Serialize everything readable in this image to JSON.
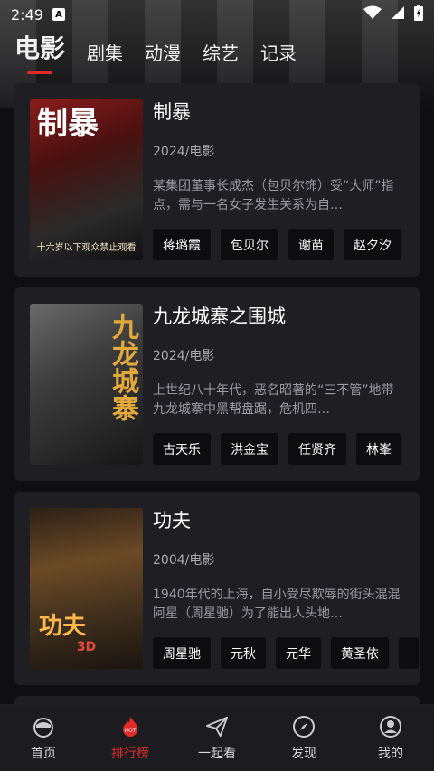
{
  "status": {
    "time": "2:49"
  },
  "categories": [
    {
      "label": "电影",
      "active": true
    },
    {
      "label": "剧集",
      "active": false
    },
    {
      "label": "动漫",
      "active": false
    },
    {
      "label": "综艺",
      "active": false
    },
    {
      "label": "记录",
      "active": false
    }
  ],
  "movies": [
    {
      "title": "制暴",
      "meta": "2024/电影",
      "desc": "某集团董事长成杰（包贝尔饰）受“大师”指点，需与一名女子发生关系为自…",
      "poster_text": "十六岁以下观众禁止观看",
      "poster_big": "制暴",
      "tags": [
        "蒋璐霞",
        "包贝尔",
        "谢苗",
        "赵夕汐"
      ]
    },
    {
      "title": "九龙城寨之围城",
      "meta": "2024/电影",
      "desc": "上世纪八十年代，恶名昭著的“三不管”地带九龙城寨中黑帮盘踞，危机四…",
      "poster_big": "九龙城寨",
      "tags": [
        "古天乐",
        "洪金宝",
        "任贤齐",
        "林峯"
      ]
    },
    {
      "title": "功夫",
      "meta": "2004/电影",
      "desc": "1940年代的上海，自小受尽欺辱的街头混混阿星（周星驰）为了能出人头地…",
      "poster_big": "功夫",
      "poster_sub": "3D",
      "tags": [
        "周星驰",
        "元秋",
        "元华",
        "黄圣依",
        ""
      ]
    }
  ],
  "bottom_nav": [
    {
      "label": "首页",
      "icon": "home-icon",
      "active": false
    },
    {
      "label": "排行榜",
      "icon": "hot-icon",
      "active": true
    },
    {
      "label": "一起看",
      "icon": "paper-plane-icon",
      "active": false
    },
    {
      "label": "发现",
      "icon": "compass-icon",
      "active": false
    },
    {
      "label": "我的",
      "icon": "profile-icon",
      "active": false
    }
  ],
  "colors": {
    "accent": "#e02b2b",
    "card": "#1f1f23",
    "background": "#0f0f12"
  }
}
